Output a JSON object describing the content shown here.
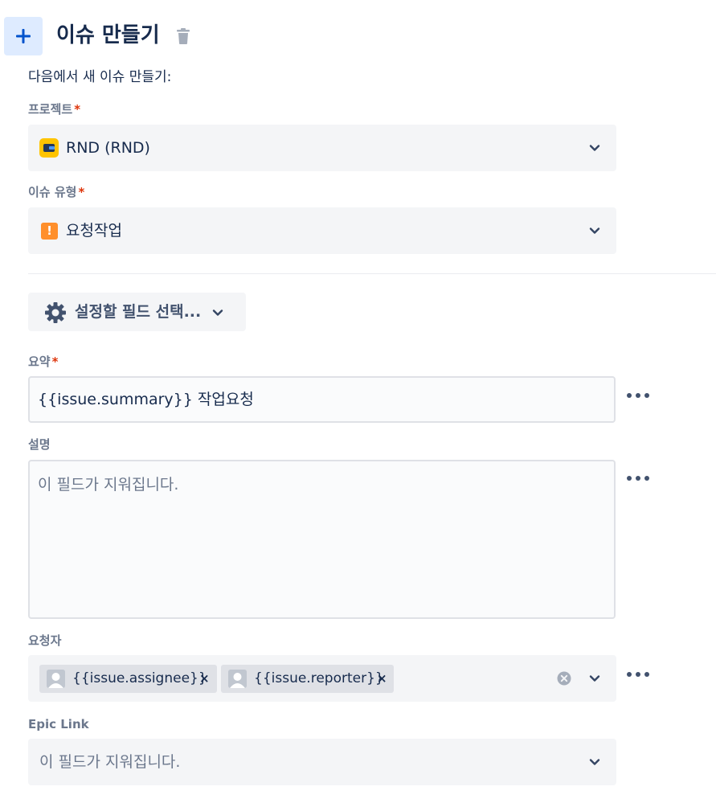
{
  "header": {
    "title": "이슈 만들기",
    "add_icon": "plus-icon",
    "delete_icon": "trash-icon"
  },
  "subtitle": "다음에서 새 이슈 만들기:",
  "project": {
    "label": "프로젝트",
    "value": "RND (RND)",
    "icon": "project-avatar-icon"
  },
  "issue_type": {
    "label": "이슈 유형",
    "value": "요청작업",
    "icon": "exclamation-icon"
  },
  "field_picker": {
    "label": "설정할 필드 선택...",
    "icon": "gear-icon"
  },
  "summary": {
    "label": "요약",
    "value": "{{issue.summary}} 작업요청"
  },
  "description": {
    "label": "설명",
    "placeholder": "이 필드가 지워집니다."
  },
  "requester": {
    "label": "요청자",
    "chips": [
      {
        "text": "{{issue.assignee}}",
        "remove": "×"
      },
      {
        "text": "{{issue.reporter}}",
        "remove": "×"
      }
    ]
  },
  "epic_link": {
    "label": "Epic Link",
    "placeholder": "이 필드가 지워집니다."
  },
  "required_mark": "*",
  "colors": {
    "accent_bg": "#deebff",
    "accent": "#0052cc",
    "required": "#de350b",
    "issue_type": "#ff8f2b",
    "project": "#ffc400"
  }
}
